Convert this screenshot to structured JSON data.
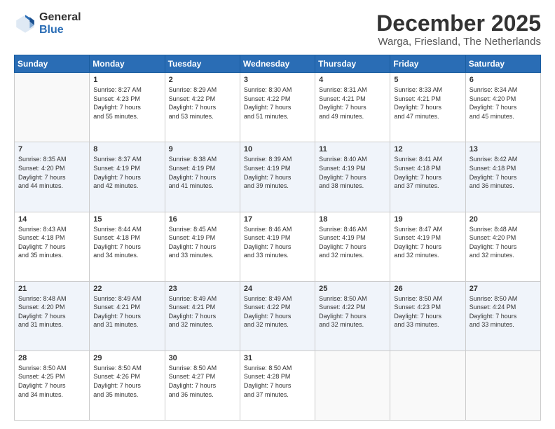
{
  "logo": {
    "general": "General",
    "blue": "Blue"
  },
  "header": {
    "month": "December 2025",
    "location": "Warga, Friesland, The Netherlands"
  },
  "days_of_week": [
    "Sunday",
    "Monday",
    "Tuesday",
    "Wednesday",
    "Thursday",
    "Friday",
    "Saturday"
  ],
  "weeks": [
    [
      {
        "day": "",
        "info": ""
      },
      {
        "day": "1",
        "info": "Sunrise: 8:27 AM\nSunset: 4:23 PM\nDaylight: 7 hours\nand 55 minutes."
      },
      {
        "day": "2",
        "info": "Sunrise: 8:29 AM\nSunset: 4:22 PM\nDaylight: 7 hours\nand 53 minutes."
      },
      {
        "day": "3",
        "info": "Sunrise: 8:30 AM\nSunset: 4:22 PM\nDaylight: 7 hours\nand 51 minutes."
      },
      {
        "day": "4",
        "info": "Sunrise: 8:31 AM\nSunset: 4:21 PM\nDaylight: 7 hours\nand 49 minutes."
      },
      {
        "day": "5",
        "info": "Sunrise: 8:33 AM\nSunset: 4:21 PM\nDaylight: 7 hours\nand 47 minutes."
      },
      {
        "day": "6",
        "info": "Sunrise: 8:34 AM\nSunset: 4:20 PM\nDaylight: 7 hours\nand 45 minutes."
      }
    ],
    [
      {
        "day": "7",
        "info": "Sunrise: 8:35 AM\nSunset: 4:20 PM\nDaylight: 7 hours\nand 44 minutes."
      },
      {
        "day": "8",
        "info": "Sunrise: 8:37 AM\nSunset: 4:19 PM\nDaylight: 7 hours\nand 42 minutes."
      },
      {
        "day": "9",
        "info": "Sunrise: 8:38 AM\nSunset: 4:19 PM\nDaylight: 7 hours\nand 41 minutes."
      },
      {
        "day": "10",
        "info": "Sunrise: 8:39 AM\nSunset: 4:19 PM\nDaylight: 7 hours\nand 39 minutes."
      },
      {
        "day": "11",
        "info": "Sunrise: 8:40 AM\nSunset: 4:19 PM\nDaylight: 7 hours\nand 38 minutes."
      },
      {
        "day": "12",
        "info": "Sunrise: 8:41 AM\nSunset: 4:18 PM\nDaylight: 7 hours\nand 37 minutes."
      },
      {
        "day": "13",
        "info": "Sunrise: 8:42 AM\nSunset: 4:18 PM\nDaylight: 7 hours\nand 36 minutes."
      }
    ],
    [
      {
        "day": "14",
        "info": "Sunrise: 8:43 AM\nSunset: 4:18 PM\nDaylight: 7 hours\nand 35 minutes."
      },
      {
        "day": "15",
        "info": "Sunrise: 8:44 AM\nSunset: 4:18 PM\nDaylight: 7 hours\nand 34 minutes."
      },
      {
        "day": "16",
        "info": "Sunrise: 8:45 AM\nSunset: 4:19 PM\nDaylight: 7 hours\nand 33 minutes."
      },
      {
        "day": "17",
        "info": "Sunrise: 8:46 AM\nSunset: 4:19 PM\nDaylight: 7 hours\nand 33 minutes."
      },
      {
        "day": "18",
        "info": "Sunrise: 8:46 AM\nSunset: 4:19 PM\nDaylight: 7 hours\nand 32 minutes."
      },
      {
        "day": "19",
        "info": "Sunrise: 8:47 AM\nSunset: 4:19 PM\nDaylight: 7 hours\nand 32 minutes."
      },
      {
        "day": "20",
        "info": "Sunrise: 8:48 AM\nSunset: 4:20 PM\nDaylight: 7 hours\nand 32 minutes."
      }
    ],
    [
      {
        "day": "21",
        "info": "Sunrise: 8:48 AM\nSunset: 4:20 PM\nDaylight: 7 hours\nand 31 minutes."
      },
      {
        "day": "22",
        "info": "Sunrise: 8:49 AM\nSunset: 4:21 PM\nDaylight: 7 hours\nand 31 minutes."
      },
      {
        "day": "23",
        "info": "Sunrise: 8:49 AM\nSunset: 4:21 PM\nDaylight: 7 hours\nand 32 minutes."
      },
      {
        "day": "24",
        "info": "Sunrise: 8:49 AM\nSunset: 4:22 PM\nDaylight: 7 hours\nand 32 minutes."
      },
      {
        "day": "25",
        "info": "Sunrise: 8:50 AM\nSunset: 4:22 PM\nDaylight: 7 hours\nand 32 minutes."
      },
      {
        "day": "26",
        "info": "Sunrise: 8:50 AM\nSunset: 4:23 PM\nDaylight: 7 hours\nand 33 minutes."
      },
      {
        "day": "27",
        "info": "Sunrise: 8:50 AM\nSunset: 4:24 PM\nDaylight: 7 hours\nand 33 minutes."
      }
    ],
    [
      {
        "day": "28",
        "info": "Sunrise: 8:50 AM\nSunset: 4:25 PM\nDaylight: 7 hours\nand 34 minutes."
      },
      {
        "day": "29",
        "info": "Sunrise: 8:50 AM\nSunset: 4:26 PM\nDaylight: 7 hours\nand 35 minutes."
      },
      {
        "day": "30",
        "info": "Sunrise: 8:50 AM\nSunset: 4:27 PM\nDaylight: 7 hours\nand 36 minutes."
      },
      {
        "day": "31",
        "info": "Sunrise: 8:50 AM\nSunset: 4:28 PM\nDaylight: 7 hours\nand 37 minutes."
      },
      {
        "day": "",
        "info": ""
      },
      {
        "day": "",
        "info": ""
      },
      {
        "day": "",
        "info": ""
      }
    ]
  ]
}
